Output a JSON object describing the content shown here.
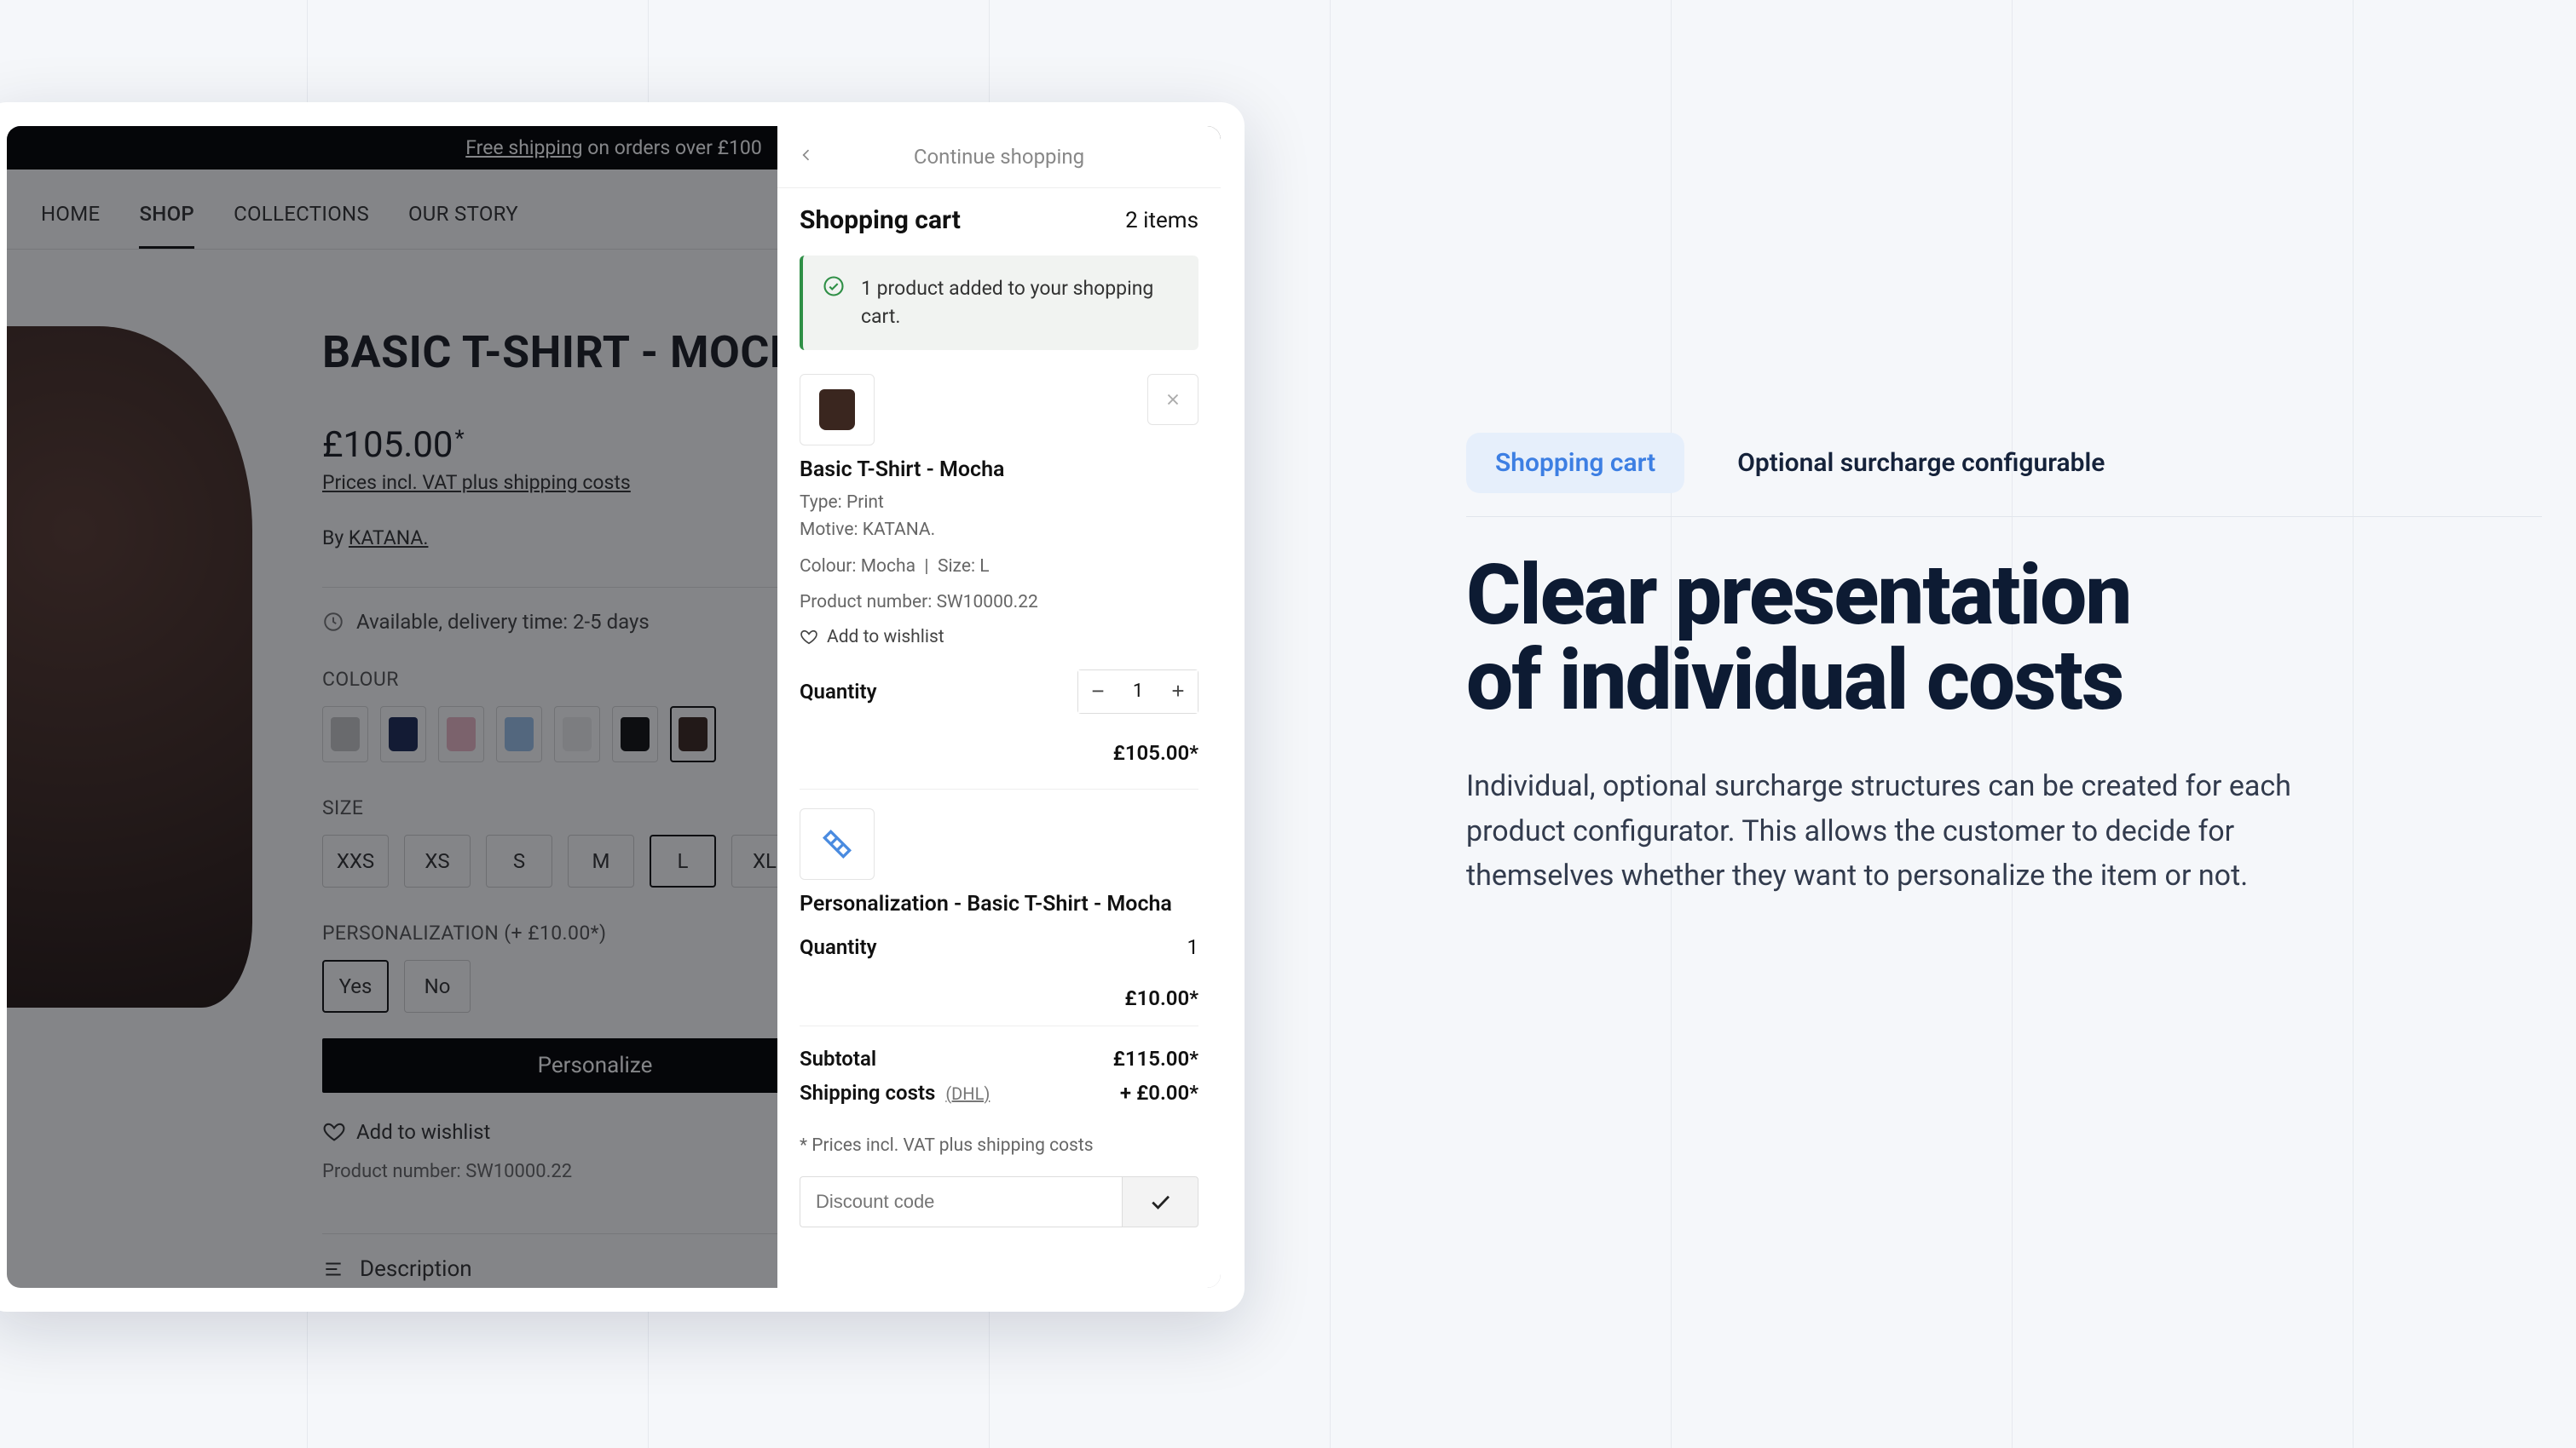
{
  "promo": {
    "free_shipping": "Free shipping",
    "rest": " on orders over £100"
  },
  "nav": {
    "items": [
      "HOME",
      "SHOP",
      "COLLECTIONS",
      "OUR STORY"
    ],
    "active_index": 1
  },
  "product": {
    "title": "BASIC T-SHIRT - MOCHA",
    "price": "£105.00",
    "vat_note": "Prices incl. VAT plus shipping costs",
    "by_prefix": "By ",
    "brand": "KATANA.",
    "availability": "Available, delivery time: 2-5 days",
    "colour_label": "COLOUR",
    "colours": [
      {
        "name": "grey",
        "hex": "#c9c9c9"
      },
      {
        "name": "navy",
        "hex": "#1c2a57"
      },
      {
        "name": "pink",
        "hex": "#edb9c6"
      },
      {
        "name": "sky",
        "hex": "#9cc3ea"
      },
      {
        "name": "white",
        "hex": "#efefef"
      },
      {
        "name": "black",
        "hex": "#111111"
      },
      {
        "name": "mocha",
        "hex": "#3a261f"
      }
    ],
    "colour_selected_index": 6,
    "size_label": "SIZE",
    "sizes": [
      "XXS",
      "XS",
      "S",
      "M",
      "L",
      "XL"
    ],
    "size_selected_index": 4,
    "pers_label": "PERSONALIZATION (+ £10.00*)",
    "pers_options": [
      "Yes",
      "No"
    ],
    "pers_selected_index": 0,
    "personalize_btn": "Personalize",
    "wishlist": "Add to wishlist",
    "product_number_label": "Product number: ",
    "product_number": "SW10000.22",
    "description_label": "Description"
  },
  "cart": {
    "continue": "Continue shopping",
    "title": "Shopping cart",
    "count_text": "2 items",
    "added_msg": "1 product added to your shopping cart.",
    "item1": {
      "name": "Basic T-Shirt - Mocha",
      "type_label": "Type: ",
      "type": "Print",
      "motive_label": "Motive: ",
      "motive": "KATANA.",
      "colour_label": "Colour: ",
      "colour": "Mocha",
      "size_label": "Size: ",
      "size": "L",
      "pn_label": "Product number: ",
      "pn": "SW10000.22",
      "wishlist": "Add to wishlist",
      "qty_label": "Quantity",
      "qty": "1",
      "line_price": "£105.00*"
    },
    "item2": {
      "name": "Personalization - Basic T-Shirt - Mocha",
      "qty_label": "Quantity",
      "qty": "1",
      "line_price": "£10.00*"
    },
    "subtotal_label": "Subtotal",
    "subtotal": "£115.00*",
    "shipping_label": "Shipping costs",
    "shipping_carrier": "(DHL)",
    "shipping": "+ £0.00*",
    "vat_footnote": "* Prices incl. VAT plus shipping costs",
    "discount_placeholder": "Discount code"
  },
  "marketing": {
    "tab_active": "Shopping cart",
    "tab_inactive": "Optional surcharge configurable",
    "headline_l1": "Clear presentation",
    "headline_l2": "of individual costs",
    "body": "Individual, optional surcharge structures can be created for each product configurator. This allows the customer to decide for themselves whether they want to personalize the item or not."
  }
}
